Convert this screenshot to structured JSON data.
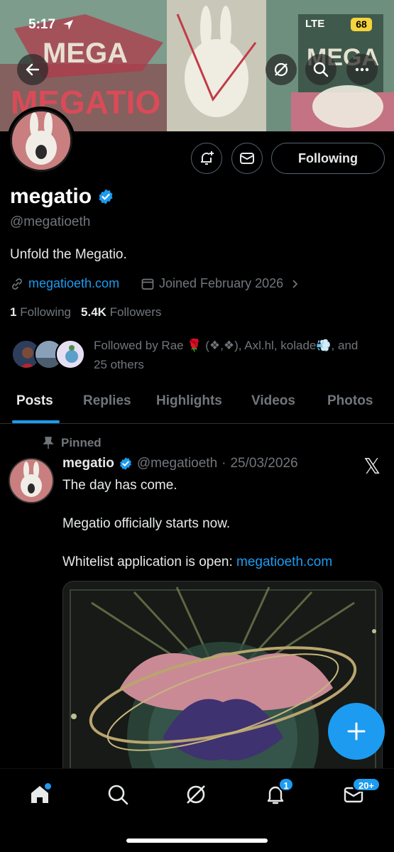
{
  "status_bar": {
    "time": "5:17",
    "network": "LTE",
    "battery": "68"
  },
  "banner": {
    "art_texts": [
      "MEGA",
      "MEGATIO",
      "MEGA"
    ]
  },
  "header_actions": {
    "back_icon": "arrow-left-icon",
    "grok_icon": "grok-icon",
    "search_icon": "search-icon",
    "more_icon": "more-icon"
  },
  "profile": {
    "display_name": "megatio",
    "handle": "@megatioeth",
    "bio": "Unfold the Megatio.",
    "website": "megatioeth.com",
    "joined": "Joined February 2026",
    "following_count": "1",
    "following_label": "Following",
    "followers_count": "5.4K",
    "followers_label": "Followers",
    "followed_by_text": "Followed by Rae 🌹 (❖,❖), Axl.hl, kolade💨, and 25 others",
    "follow_button_label": "Following"
  },
  "tabs": [
    {
      "label": "Posts",
      "active": true
    },
    {
      "label": "Replies",
      "active": false
    },
    {
      "label": "Highlights",
      "active": false
    },
    {
      "label": "Videos",
      "active": false
    },
    {
      "label": "Photos",
      "active": false
    }
  ],
  "post": {
    "pinned_label": "Pinned",
    "author_name": "megatio",
    "author_handle": "@megatioeth",
    "date_sep": "·",
    "date": "25/03/2026",
    "line1": "The day has come.",
    "line2": "Megatio officially starts now.",
    "line3_prefix": "Whitelist application is open: ",
    "line3_link": "megatioeth.com",
    "x_logo": "𝕏"
  },
  "bottom_nav": {
    "notifications_badge": "1",
    "messages_badge": "20+"
  },
  "colors": {
    "accent": "#1d9bf0",
    "background": "#000000",
    "muted": "#71767b"
  }
}
